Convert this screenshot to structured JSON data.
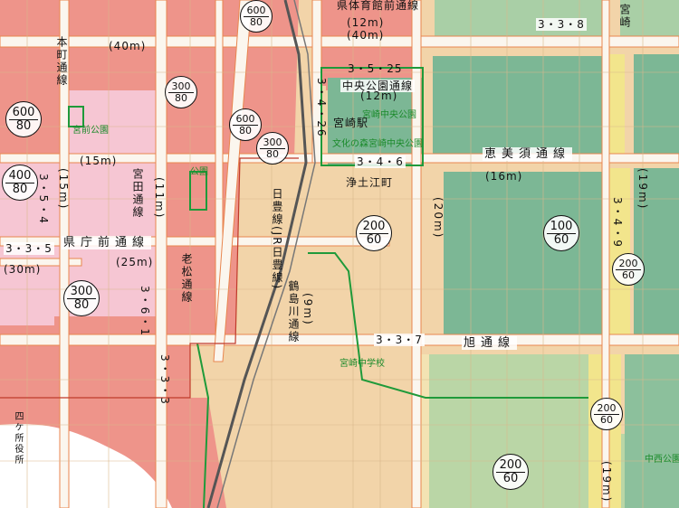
{
  "streets": {
    "taiiku_kaikan": "県体育館前通線",
    "taiiku_kaikan_w1": "(12m)",
    "taiiku_kaikan_w2": "(40m)",
    "chuo_koen": "中央公園通線",
    "chuo_koen_w": "(12m)",
    "ebisu": "恵美須通線",
    "ebisu_w": "(16m)",
    "asahi": "旭通線",
    "kenchomae": "県庁前通線",
    "honmachi": "本町通線",
    "miyata": "宮田通線",
    "rouma": "老松通線",
    "tsuruga": "鶴島川通線",
    "tsuruga_w": "(9m)",
    "nippo": "日豊線(JR日豊線)",
    "miyazaki_st": "宮崎駅",
    "w_40m": "(40m)",
    "w_15m_a": "(15m)",
    "w_15m_b": "(15m)",
    "w_11m": "(11m)",
    "w_25m": "(25m)",
    "w_30m": "(30m)",
    "w_20m": "(20m)",
    "w_19m_a": "(19m)",
    "w_19m_b": "(19m)",
    "miyazaki_e": "宮崎",
    "jodo": "浄土江町"
  },
  "route_numbers": {
    "r338": "3・3・8",
    "r3525": "3・5・25",
    "r3426": "3・4・26",
    "r346": "3・4・6",
    "r354": "3・5・4",
    "r335": "3・3・5",
    "r316": "3・6・1",
    "r333": "3・3・3",
    "r337": "3・3・7",
    "r349": "3・4・9"
  },
  "facilities": {
    "chuo_koen": "宮崎中央公園",
    "bunka": "文化の森宮崎中央公園",
    "kencho": "四ケ所役所",
    "park1": "宮前公園",
    "park2": "公園",
    "jhs": "宮崎中学校",
    "park3": "中西公園"
  },
  "zoning": [
    {
      "far": "600",
      "bcr": "80"
    },
    {
      "far": "400",
      "bcr": "80"
    },
    {
      "far": "300",
      "bcr": "80"
    },
    {
      "far": "600",
      "bcr": "80"
    },
    {
      "far": "300",
      "bcr": "80"
    },
    {
      "far": "200",
      "bcr": "60"
    },
    {
      "far": "100",
      "bcr": "60"
    },
    {
      "far": "200",
      "bcr": "60"
    },
    {
      "far": "200",
      "bcr": "60"
    },
    {
      "far": "200",
      "bcr": "60"
    },
    {
      "far": "600",
      "bcr": "80"
    },
    {
      "far": "300",
      "bcr": "80"
    }
  ],
  "colors": {
    "commercial": "#ee8f84",
    "neighborhood_commercial": "#f6c3d2",
    "residential1": "#f3d8ae",
    "residential2": "#f4e6b8",
    "low_residential": "#79b592",
    "mid_residential": "#b9d6a6",
    "road": "#f8f3ec",
    "road_edge": "#e67a46",
    "river": "#ffffff",
    "rail": "#666666",
    "green_line": "#1f9a3a",
    "yellow_band": "#f1e58a"
  }
}
